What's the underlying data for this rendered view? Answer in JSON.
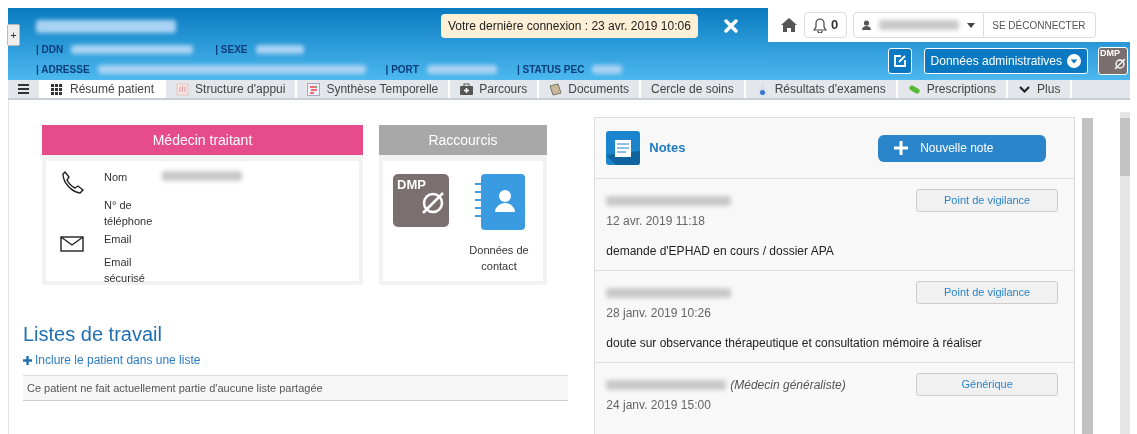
{
  "header": {
    "expand_button": "+",
    "last_login": "Votre dernière connexion : 23 avr. 2019 10:06",
    "labels_row1": [
      "| DDN",
      "| SEXE"
    ],
    "labels_row2": [
      "| ADRESSE",
      "| PORT",
      "| STATUS PEC"
    ],
    "notification_count": "0",
    "logout": "SE DÉCONNECTER",
    "admin_button": "Données administratives",
    "dmp_button": "DMP"
  },
  "tabs": [
    {
      "label": "Résumé patient",
      "selected": true
    },
    {
      "label": "Structure d'appui",
      "selected": false
    },
    {
      "label": "Synthèse Temporelle",
      "selected": false
    },
    {
      "label": "Parcours",
      "selected": false
    },
    {
      "label": "Documents",
      "selected": false
    },
    {
      "label": "Cercle de soins",
      "selected": false
    },
    {
      "label": "Résultats d'examens",
      "selected": false
    },
    {
      "label": "Prescriptions",
      "selected": false
    },
    {
      "label": "Plus",
      "selected": false
    }
  ],
  "doctor_card": {
    "title": "Médecin traitant",
    "fields": [
      "Nom",
      "N° de téléphone",
      "Email",
      "Email sécurisé"
    ]
  },
  "shortcuts": {
    "title": "Raccourcis",
    "items": [
      {
        "kind": "dmp",
        "text": "DMP"
      },
      {
        "kind": "contacts",
        "label": "Données de contact"
      }
    ]
  },
  "worklists": {
    "title": "Listes de travail",
    "add_link": "Inclure le patient dans une liste",
    "empty_message": "Ce patient ne fait actuellement partie d'aucune liste partagée"
  },
  "notes": {
    "title": "Notes",
    "new_button": "Nouvelle note",
    "items": [
      {
        "date": "12 avr. 2019 11:18",
        "text": "demande d'EPHAD en cours / dossier APA",
        "tag": "Point de vigilance"
      },
      {
        "date": "28 janv. 2019 10:26",
        "text": "doute sur observance thérapeutique et consultation mémoire à réaliser",
        "tag": "Point de vigilance"
      },
      {
        "role": "(Médecin généraliste)",
        "date": "24 janv. 2019 15:00",
        "tag": "Générique"
      }
    ]
  }
}
